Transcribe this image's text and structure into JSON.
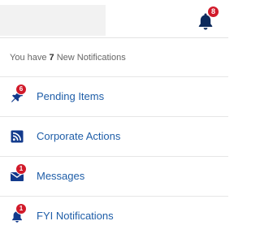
{
  "header": {
    "notification_count": "8"
  },
  "panel": {
    "summary_prefix": "You have ",
    "summary_count": "7",
    "summary_suffix": " New Notifications"
  },
  "colors": {
    "badge": "#d11a2a",
    "link": "#1f5ea8",
    "icon": "#123a8c",
    "bell": "#0d2a5c"
  },
  "items": [
    {
      "label": "Pending Items",
      "icon": "pushpin-icon",
      "badge": "6"
    },
    {
      "label": "Corporate Actions",
      "icon": "rss-feed-icon",
      "badge": ""
    },
    {
      "label": "Messages",
      "icon": "envelope-icon",
      "badge": "1"
    },
    {
      "label": "FYI Notifications",
      "icon": "bell-icon",
      "badge": "1"
    }
  ]
}
